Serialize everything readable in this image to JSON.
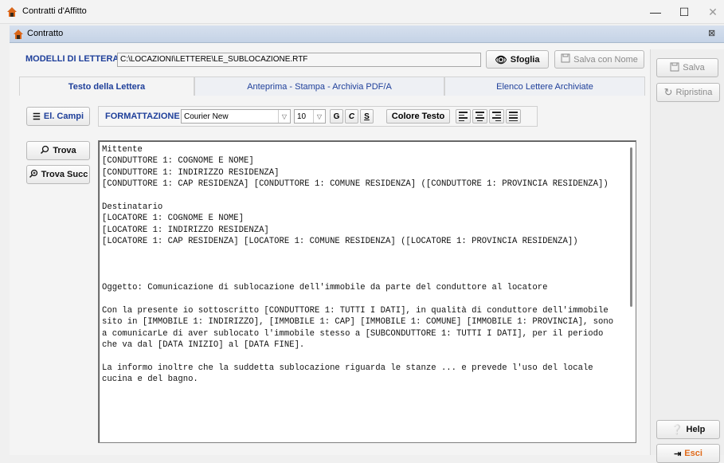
{
  "window": {
    "title": "Contratti d'Affitto",
    "controls": {
      "minimize": "—",
      "maximize": "☐",
      "close": "✕"
    }
  },
  "inner_window": {
    "title": "Contratto",
    "close": "⊠"
  },
  "template_row": {
    "label": "MODELLI DI LETTERA",
    "path": "C:\\LOCAZIONI\\LETTERE\\LE_SUBLOCAZIONE.RTF",
    "browse_label": "Sfoglia",
    "save_as_label": "Salva con Nome"
  },
  "tabs": [
    {
      "label": "Testo della Lettera",
      "active": true
    },
    {
      "label": "Anteprima - Stampa - Archivia PDF/A",
      "active": false
    },
    {
      "label": "Elenco Lettere Archiviate",
      "active": false
    }
  ],
  "left_buttons": {
    "fields": "El. Campi",
    "find": "Trova",
    "find_next": "Trova Succ"
  },
  "formatting": {
    "label": "FORMATTAZIONE",
    "font": "Courier New",
    "size": "10",
    "bold": "G",
    "italic": "C",
    "underline": "S",
    "color_label": "Colore Testo"
  },
  "right_buttons": {
    "save": "Salva",
    "restore": "Ripristina",
    "help": "Help",
    "exit": "Esci"
  },
  "document": {
    "text": "Mittente\n[CONDUTTORE 1: COGNOME E NOME]\n[CONDUTTORE 1: INDIRIZZO RESIDENZA]\n[CONDUTTORE 1: CAP RESIDENZA] [CONDUTTORE 1: COMUNE RESIDENZA] ([CONDUTTORE 1: PROVINCIA RESIDENZA])\n\nDestinatario\n[LOCATORE 1: COGNOME E NOME]\n[LOCATORE 1: INDIRIZZO RESIDENZA]\n[LOCATORE 1: CAP RESIDENZA] [LOCATORE 1: COMUNE RESIDENZA] ([LOCATORE 1: PROVINCIA RESIDENZA])\n\n\n\nOggetto: Comunicazione di sublocazione dell'immobile da parte del conduttore al locatore\n\nCon la presente io sottoscritto [CONDUTTORE 1: TUTTI I DATI], in qualità di conduttore dell'immobile sito in [IMMOBILE 1: INDIRIZZO], [IMMOBILE 1: CAP] [IMMOBILE 1: COMUNE] [IMMOBILE 1: PROVINCIA], sono a comunicarLe di aver sublocato l'immobile stesso a [SUBCONDUTTORE 1: TUTTI I DATI], per il periodo che va dal [DATA INIZIO] al [DATA FINE].\n\nLa informo inoltre che la suddetta sublocazione riguarda le stanze ... e prevede l'uso del locale cucina e del bagno."
  },
  "colors": {
    "accent": "#1e3f9a",
    "exit": "#e06a1a",
    "icon_orange": "#d9661a"
  }
}
